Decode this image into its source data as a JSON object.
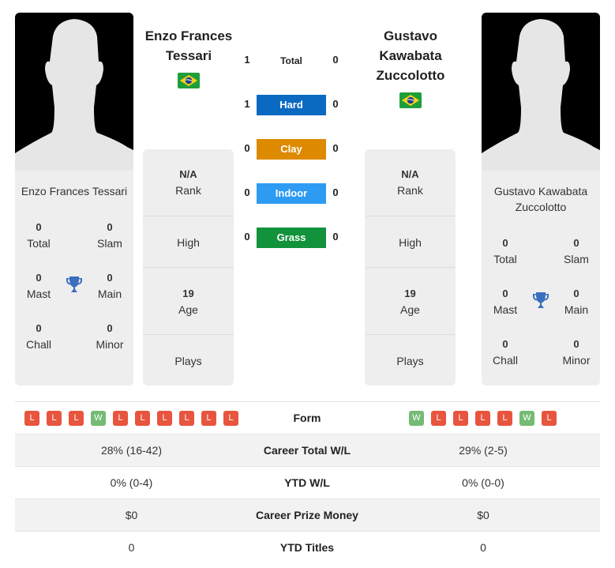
{
  "colors": {
    "hard": "#0a6ac2",
    "clay": "#dd8a00",
    "indoor": "#2e9bf2",
    "grass": "#11923b",
    "loss": "#e8553e",
    "win": "#74bb74",
    "trophy": "#3a6fbf"
  },
  "player1": {
    "name_header_line1": "Enzo Frances",
    "name_header_line2": "Tessari",
    "card_name": "Enzo Frances Tessari",
    "flag_icon": "brazil-flag-icon",
    "titles": {
      "total": {
        "value": "0",
        "label": "Total"
      },
      "slam": {
        "value": "0",
        "label": "Slam"
      },
      "mast": {
        "value": "0",
        "label": "Mast"
      },
      "main": {
        "value": "0",
        "label": "Main"
      },
      "chall": {
        "value": "0",
        "label": "Chall"
      },
      "minor": {
        "value": "0",
        "label": "Minor"
      }
    },
    "stats": {
      "rank_value": "N/A",
      "rank_label": "Rank",
      "high_label": "High",
      "age_value": "19",
      "age_label": "Age",
      "plays_label": "Plays"
    },
    "form": [
      "L",
      "L",
      "L",
      "W",
      "L",
      "L",
      "L",
      "L",
      "L",
      "L"
    ],
    "career_wl": "28% (16-42)",
    "ytd_wl": "0% (0-4)",
    "prize_money": "$0",
    "ytd_titles": "0"
  },
  "player2": {
    "name_header_line1": "Gustavo",
    "name_header_line2": "Kawabata",
    "name_header_line3": "Zuccolotto",
    "card_name_line1": "Gustavo Kawabata",
    "card_name_line2": "Zuccolotto",
    "flag_icon": "brazil-flag-icon",
    "titles": {
      "total": {
        "value": "0",
        "label": "Total"
      },
      "slam": {
        "value": "0",
        "label": "Slam"
      },
      "mast": {
        "value": "0",
        "label": "Mast"
      },
      "main": {
        "value": "0",
        "label": "Main"
      },
      "chall": {
        "value": "0",
        "label": "Chall"
      },
      "minor": {
        "value": "0",
        "label": "Minor"
      }
    },
    "stats": {
      "rank_value": "N/A",
      "rank_label": "Rank",
      "high_label": "High",
      "age_value": "19",
      "age_label": "Age",
      "plays_label": "Plays"
    },
    "form": [
      "W",
      "L",
      "L",
      "L",
      "L",
      "W",
      "L"
    ],
    "career_wl": "29% (2-5)",
    "ytd_wl": "0% (0-0)",
    "prize_money": "$0",
    "ytd_titles": "0"
  },
  "h2h": {
    "total": {
      "label": "Total",
      "p1": "1",
      "p2": "0"
    },
    "hard": {
      "label": "Hard",
      "p1": "1",
      "p2": "0"
    },
    "clay": {
      "label": "Clay",
      "p1": "0",
      "p2": "0"
    },
    "indoor": {
      "label": "Indoor",
      "p1": "0",
      "p2": "0"
    },
    "grass": {
      "label": "Grass",
      "p1": "0",
      "p2": "0"
    }
  },
  "table": {
    "form_label": "Form",
    "career_wl_label": "Career Total W/L",
    "ytd_wl_label": "YTD W/L",
    "prize_label": "Career Prize Money",
    "ytd_titles_label": "YTD Titles"
  }
}
